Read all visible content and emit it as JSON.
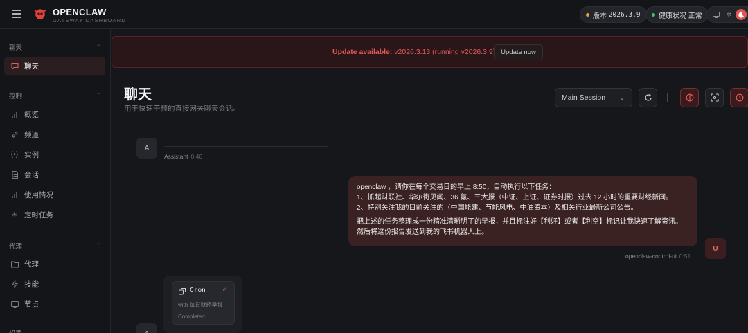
{
  "app": {
    "title": "OPENCLAW",
    "subtitle": "GATEWAY DASHBOARD"
  },
  "topbar": {
    "version_label": "版本",
    "version_value": "2026.3.9",
    "health_label": "健康状况",
    "health_value": "正常"
  },
  "sidebar": {
    "sections": [
      {
        "label": "聊天",
        "items": [
          {
            "label": "聊天",
            "icon": "chat-icon",
            "active": true
          }
        ]
      },
      {
        "label": "控制",
        "items": [
          {
            "label": "概览",
            "icon": "bar-chart-icon"
          },
          {
            "label": "频道",
            "icon": "link-icon"
          },
          {
            "label": "实例",
            "icon": "radio-icon"
          },
          {
            "label": "会话",
            "icon": "file-icon"
          },
          {
            "label": "使用情况",
            "icon": "bar-chart-icon"
          },
          {
            "label": "定时任务",
            "icon": "loader-icon"
          }
        ]
      },
      {
        "label": "代理",
        "items": [
          {
            "label": "代理",
            "icon": "folder-icon"
          },
          {
            "label": "技能",
            "icon": "zap-icon"
          },
          {
            "label": "节点",
            "icon": "monitor-icon"
          }
        ]
      },
      {
        "label": "设置",
        "items": []
      }
    ],
    "collapse_glyph": "−"
  },
  "banner": {
    "prefix": "Update available:",
    "message": " v2026.3.13 (running v2026.3.9).",
    "button": "Update now"
  },
  "page": {
    "title": "聊天",
    "subtitle": "用于快速干预的直接网关聊天会话。"
  },
  "toolbar": {
    "session_select": "Main Session",
    "separator": "|"
  },
  "chat": {
    "assistant": {
      "avatar": "A",
      "name": "Assistant",
      "time": "0:46"
    },
    "user_message": {
      "lines": [
        "openclaw ，请你在每个交易日的早上 8:50，自动执行以下任务：",
        "1、抓起财联社、华尔街见闻、36 氪、三大报（中证、上证、证券时报）过去 12 小时的重要财经新闻。",
        "2、特别关注我的目前关注的（中国能建、节能风电、中油资本）及相关行业最新公司公告。"
      ],
      "lines2": [
        "把上述的任务整理成一份精准清晰明了的早报，并且标注好【利好】或者【利空】标记让我快速了解资讯。",
        "然后将这份报告发送到我的飞书机器人上。"
      ],
      "sender": "openclaw-control-ui",
      "time": "0:51",
      "avatar": "U"
    },
    "cron_card": {
      "title": "Cron",
      "with": "with 每日财经早报",
      "status": "Completed"
    },
    "next_avatar": "A"
  },
  "colors": {
    "accent": "#e0574f",
    "background": "#16171b",
    "sidebar": "#141518"
  }
}
